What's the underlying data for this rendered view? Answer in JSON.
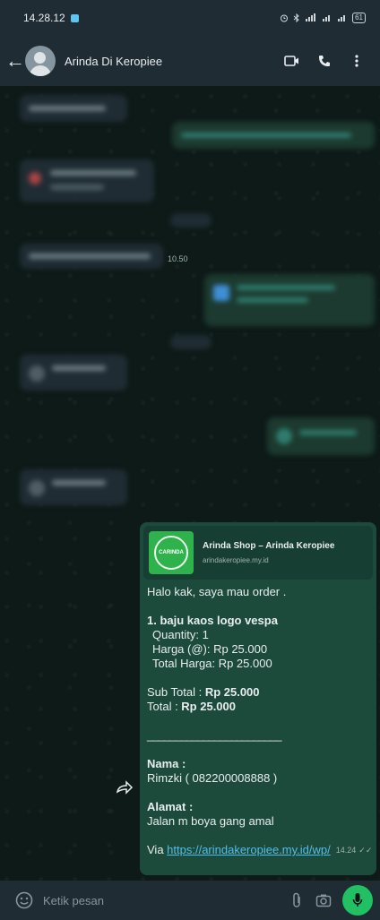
{
  "status_bar": {
    "time": "14.28.12",
    "battery": "61"
  },
  "header": {
    "contact_name": "Arinda Di Keropiee"
  },
  "blurred_times": {
    "t1": "10.50"
  },
  "message": {
    "preview_title": "Arinda Shop – Arinda Keropiee",
    "preview_domain": "arindakeropiee.my.id",
    "logo_text": "CARINDA",
    "greeting": "Halo kak, saya mau order .",
    "item_name": "1. baju kaos logo vespa",
    "quantity": "Quantity: 1",
    "price": "Harga (@): Rp 25.000",
    "total_price": "Total Harga: Rp 25.000",
    "subtotal_label": "Sub Total : ",
    "subtotal_value": "Rp 25.000",
    "total_label": "Total : ",
    "total_value": "Rp 25.000",
    "divider": "________________________",
    "name_label": "Nama :",
    "name_value": "Rimzki ( 082200008888 )",
    "address_label": "Alamat :",
    "address_value": "Jalan m boya gang amal",
    "via_label": "Via ",
    "via_link": "https://arindakeropiee.my.id/wp/",
    "time": "14.24",
    "ticks": "✓✓"
  },
  "input_bar": {
    "placeholder": "Ketik pesan"
  },
  "colors": {
    "bubble_out": "#1c4a3b",
    "header": "#1f2c34",
    "mic": "#21c063",
    "link": "#53bdeb"
  }
}
